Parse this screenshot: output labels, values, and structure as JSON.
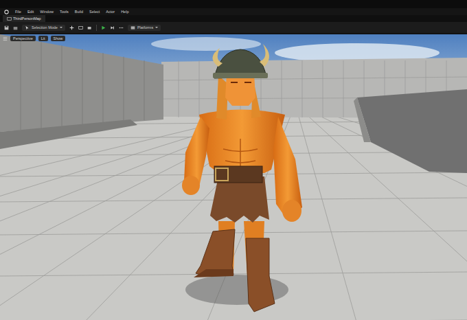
{
  "window": {
    "menu": [
      "File",
      "Edit",
      "Window",
      "Tools",
      "Build",
      "Select",
      "Actor",
      "Help"
    ]
  },
  "tabs": [
    {
      "label": "ThirdPersonMap",
      "selected": true
    }
  ],
  "toolbar": {
    "mode": "Selection Mode",
    "platforms": "Platforms"
  },
  "viewport": {
    "buttons": [
      "Perspective",
      "Lit",
      "Show"
    ]
  }
}
